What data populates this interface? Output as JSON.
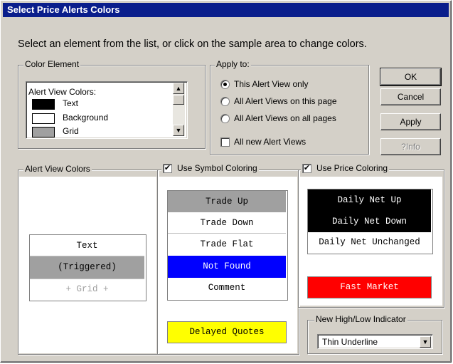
{
  "title": "Select Price Alerts Colors",
  "instruction": "Select an element from the list, or click on the sample area to change colors.",
  "color_element": {
    "legend": "Color Element",
    "header": "Alert View Colors:",
    "items": [
      {
        "label": "Text",
        "color": "#000000"
      },
      {
        "label": "Background",
        "color": "#ffffff"
      },
      {
        "label": "Grid",
        "color": "#a0a0a0"
      }
    ]
  },
  "apply_to": {
    "legend": "Apply to:",
    "options": [
      "This Alert View only",
      "All Alert Views on this page",
      "All Alert Views on all pages"
    ],
    "selected": 0,
    "new_views_label": "All new Alert Views",
    "new_views_checked": false
  },
  "buttons": {
    "ok": "OK",
    "cancel": "Cancel",
    "apply": "Apply",
    "info": "?Info"
  },
  "alert_view_colors": {
    "legend": "Alert View Colors",
    "rows": [
      {
        "label": "Text",
        "bg": "#ffffff",
        "fg": "#000000"
      },
      {
        "label": "(Triggered)",
        "bg": "#a0a0a0",
        "fg": "#000000"
      },
      {
        "label": "+ Grid +",
        "bg": "#ffffff",
        "fg": "#a0a0a0"
      }
    ]
  },
  "symbol_coloring": {
    "label": "Use Symbol Coloring",
    "checked": true,
    "rows": [
      {
        "label": "Trade Up",
        "bg": "#a0a0a0",
        "fg": "#000000"
      },
      {
        "label": "Trade Down",
        "bg": "#ffffff",
        "fg": "#000000"
      },
      {
        "label": "Trade Flat",
        "bg": "#ffffff",
        "fg": "#000000"
      },
      {
        "label": "Not Found",
        "bg": "#0000ff",
        "fg": "#ffffff"
      },
      {
        "label": "Comment",
        "bg": "#ffffff",
        "fg": "#000000"
      }
    ],
    "delayed": {
      "label": "Delayed Quotes",
      "bg": "#ffff00",
      "fg": "#000000"
    }
  },
  "price_coloring": {
    "label": "Use Price Coloring",
    "checked": true,
    "rows": [
      {
        "label": "Daily Net Up",
        "bg": "#000000",
        "fg": "#ffffff"
      },
      {
        "label": "Daily Net Down",
        "bg": "#000000",
        "fg": "#ffffff"
      },
      {
        "label": "Daily Net Unchanged",
        "bg": "#ffffff",
        "fg": "#000000"
      }
    ],
    "fast_market": {
      "label": "Fast Market",
      "bg": "#ff0000",
      "fg": "#ffffff"
    }
  },
  "indicator": {
    "legend": "New High/Low Indicator",
    "value": "Thin Underline"
  }
}
